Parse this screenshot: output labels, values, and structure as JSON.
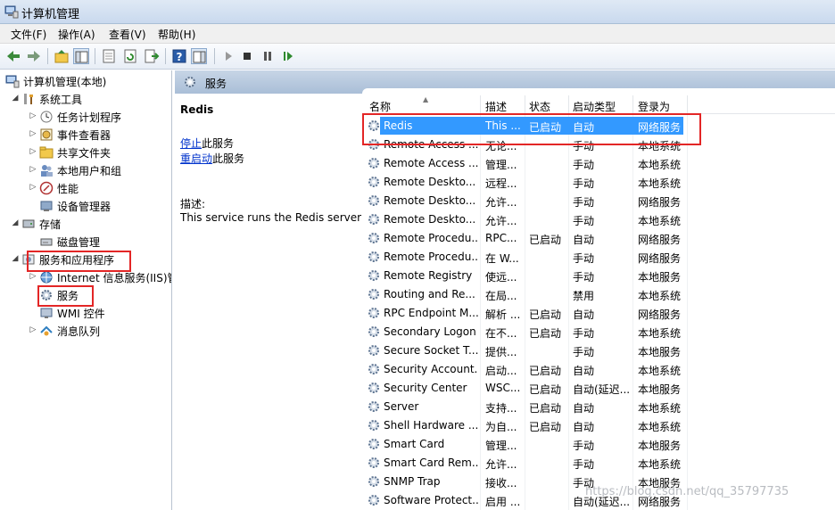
{
  "window": {
    "title": "计算机管理"
  },
  "menu": [
    "文件(F)",
    "操作(A)",
    "查看(V)",
    "帮助(H)"
  ],
  "toolbar": {
    "icons": [
      "back-icon",
      "forward-icon",
      "up-folder-icon",
      "show-hide-tree-icon",
      "properties-icon",
      "refresh-icon",
      "export-list-icon",
      "help-icon",
      "action-pane-icon",
      "start-service-icon",
      "stop-service-icon",
      "pause-service-icon",
      "resume-service-icon"
    ]
  },
  "tree": {
    "items": [
      {
        "label": "计算机管理(本地)",
        "icon": "computer-management-icon"
      },
      {
        "label": "系统工具",
        "icon": "system-tools-icon"
      },
      {
        "label": "任务计划程序",
        "icon": "task-scheduler-icon"
      },
      {
        "label": "事件查看器",
        "icon": "event-viewer-icon"
      },
      {
        "label": "共享文件夹",
        "icon": "shared-folder-icon"
      },
      {
        "label": "本地用户和组",
        "icon": "local-users-icon"
      },
      {
        "label": "性能",
        "icon": "performance-icon"
      },
      {
        "label": "设备管理器",
        "icon": "device-manager-icon"
      },
      {
        "label": "存储",
        "icon": "storage-icon"
      },
      {
        "label": "磁盘管理",
        "icon": "disk-management-icon"
      },
      {
        "label": "服务和应用程序",
        "icon": "services-apps-icon"
      },
      {
        "label": "Internet 信息服务(IIS)管",
        "icon": "iis-icon"
      },
      {
        "label": "服务",
        "icon": "services-gear-icon"
      },
      {
        "label": "WMI 控件",
        "icon": "wmi-icon"
      },
      {
        "label": "消息队列",
        "icon": "message-queue-icon"
      }
    ]
  },
  "content": {
    "header_title": "服务",
    "selected_name": "Redis",
    "stop_link": "停止",
    "stop_suffix": "此服务",
    "restart_link": "重启动",
    "restart_suffix": "此服务",
    "desc_label": "描述:",
    "desc_text": "This service runs the Redis server"
  },
  "columns": [
    "名称",
    "描述",
    "状态",
    "启动类型",
    "登录为"
  ],
  "services": [
    {
      "name": "Redis",
      "desc": "This ...",
      "status": "已启动",
      "startup": "自动",
      "logon": "网络服务"
    },
    {
      "name": "Remote Access ...",
      "desc": "无论...",
      "status": "",
      "startup": "手动",
      "logon": "本地系统"
    },
    {
      "name": "Remote Access ...",
      "desc": "管理...",
      "status": "",
      "startup": "手动",
      "logon": "本地系统"
    },
    {
      "name": "Remote Deskto...",
      "desc": "远程...",
      "status": "",
      "startup": "手动",
      "logon": "本地系统"
    },
    {
      "name": "Remote Deskto...",
      "desc": "允许...",
      "status": "",
      "startup": "手动",
      "logon": "网络服务"
    },
    {
      "name": "Remote Deskto...",
      "desc": "允许...",
      "status": "",
      "startup": "手动",
      "logon": "本地系统"
    },
    {
      "name": "Remote Procedu...",
      "desc": "RPC...",
      "status": "已启动",
      "startup": "自动",
      "logon": "网络服务"
    },
    {
      "name": "Remote Procedu...",
      "desc": "在 W...",
      "status": "",
      "startup": "手动",
      "logon": "网络服务"
    },
    {
      "name": "Remote Registry",
      "desc": "使远...",
      "status": "",
      "startup": "手动",
      "logon": "本地服务"
    },
    {
      "name": "Routing and Re...",
      "desc": "在局...",
      "status": "",
      "startup": "禁用",
      "logon": "本地系统"
    },
    {
      "name": "RPC Endpoint M...",
      "desc": "解析 ...",
      "status": "已启动",
      "startup": "自动",
      "logon": "网络服务"
    },
    {
      "name": "Secondary Logon",
      "desc": "在不...",
      "status": "已启动",
      "startup": "手动",
      "logon": "本地系统"
    },
    {
      "name": "Secure Socket T...",
      "desc": "提供...",
      "status": "",
      "startup": "手动",
      "logon": "本地服务"
    },
    {
      "name": "Security Account...",
      "desc": "启动...",
      "status": "已启动",
      "startup": "自动",
      "logon": "本地系统"
    },
    {
      "name": "Security Center",
      "desc": "WSC...",
      "status": "已启动",
      "startup": "自动(延迟...",
      "logon": "本地服务"
    },
    {
      "name": "Server",
      "desc": "支持...",
      "status": "已启动",
      "startup": "自动",
      "logon": "本地系统"
    },
    {
      "name": "Shell Hardware ...",
      "desc": "为自...",
      "status": "已启动",
      "startup": "自动",
      "logon": "本地系统"
    },
    {
      "name": "Smart Card",
      "desc": "管理...",
      "status": "",
      "startup": "手动",
      "logon": "本地服务"
    },
    {
      "name": "Smart Card Rem...",
      "desc": "允许...",
      "status": "",
      "startup": "手动",
      "logon": "本地系统"
    },
    {
      "name": "SNMP Trap",
      "desc": "接收...",
      "status": "",
      "startup": "手动",
      "logon": "本地服务"
    },
    {
      "name": "Software Protect...",
      "desc": "启用 ...",
      "status": "",
      "startup": "自动(延迟...",
      "logon": "网络服务"
    }
  ],
  "watermark": "https://blog.csdn.net/qq_35797735",
  "colors": {
    "selection": "#3399ff",
    "highlight_box": "#e32626",
    "link": "#0033cc"
  }
}
